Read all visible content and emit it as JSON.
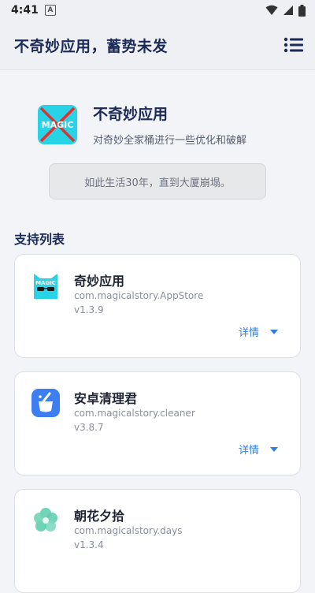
{
  "status_bar": {
    "time": "4:41",
    "notification_letter": "A"
  },
  "app_bar": {
    "title": "不奇妙应用，蓄势未发"
  },
  "hero": {
    "icon_text": "MAGIC",
    "title": "不奇妙应用",
    "subtitle": "对奇妙全家桶进行一些优化和破解"
  },
  "quote": "如此生活30年，直到大厦崩塌。",
  "support_section": {
    "title": "支持列表",
    "details_label": "详情",
    "apps": [
      {
        "name": "奇妙应用",
        "package": "com.magicalstory.AppStore",
        "version": "v1.3.9",
        "icon": "magic-cat-icon"
      },
      {
        "name": "安卓清理君",
        "package": "com.magicalstory.cleaner",
        "version": "v3.8.7",
        "icon": "broom-bucket-icon"
      },
      {
        "name": "朝花夕拾",
        "package": "com.magicalstory.days",
        "version": "v1.3.4",
        "icon": "flower-icon"
      }
    ]
  },
  "colors": {
    "accent": "#2f7de1",
    "title": "#1c2a57",
    "icon_cyan": "#29d3e6",
    "cleaner_blue": "#3d7ef0",
    "flower_green": "#5fcfae"
  }
}
